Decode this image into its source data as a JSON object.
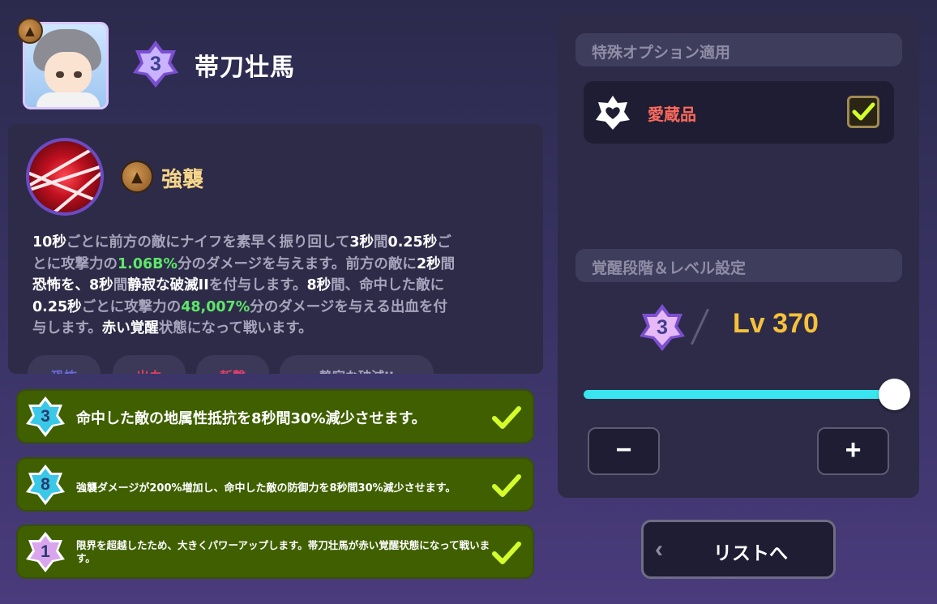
{
  "character": {
    "name": "帯刀壮馬",
    "awakening_stage": "3",
    "class_icon": "rock-class-icon"
  },
  "skill": {
    "name": "強襲",
    "icon": "red-slash-skill-icon",
    "class_icon": "rock-class-icon",
    "description": [
      [
        {
          "t": "10秒",
          "w": 1
        },
        {
          "t": "ごとに前方の敵にナイフを素早く振り回して"
        },
        {
          "t": "3秒",
          "w": 1
        },
        {
          "t": "間"
        },
        {
          "t": "0.25秒",
          "w": 1
        },
        {
          "t": "ご"
        }
      ],
      [
        {
          "t": "とに攻撃力の"
        },
        {
          "t": "1.06B%",
          "g": 1
        },
        {
          "t": "分のダメージを与えます。前方の敵に"
        },
        {
          "t": "2秒",
          "w": 1
        },
        {
          "t": "間"
        }
      ],
      [
        {
          "t": "恐怖を、",
          "w": 1
        },
        {
          "t": "8秒",
          "w": 1
        },
        {
          "t": "間"
        },
        {
          "t": "静寂な破滅II",
          "w": 1
        },
        {
          "t": "を付与します。"
        },
        {
          "t": "8秒",
          "w": 1
        },
        {
          "t": "間、命中した敵に"
        }
      ],
      [
        {
          "t": "0.25秒",
          "w": 1
        },
        {
          "t": "ごとに攻撃力の"
        },
        {
          "t": "48,007%",
          "g": 1
        },
        {
          "t": "分のダメージを与える出血を付"
        }
      ],
      [
        {
          "t": "与します。"
        },
        {
          "t": "赤い覚醒",
          "w": 1
        },
        {
          "t": "状態になって戦います。"
        }
      ]
    ],
    "tags": [
      {
        "label": "恐怖",
        "color": "#6e6be0"
      },
      {
        "label": "出血",
        "color": "#e0405a"
      },
      {
        "label": "斬撃",
        "color": "#e0406e"
      },
      {
        "label": "静寂な破滅II",
        "color": "#a9a6c2"
      }
    ]
  },
  "effects": [
    {
      "stage": "3",
      "badge_color": "#3ac8e8",
      "text": "命中した敵の地属性抵抗を8秒間30%減少させます。",
      "checked": true
    },
    {
      "stage": "8",
      "badge_color": "#3ac8e8",
      "text": "強襲ダメージが200%増加し、命中した敵の防御力を8秒間30%減少させます。",
      "checked": true
    },
    {
      "stage": "1",
      "badge_color": "#d9a6ee",
      "text": "限界を超越したため、大きくパワーアップします。帯刀壮馬が赤い覚醒状態になって戦います。",
      "checked": true
    }
  ],
  "options": {
    "section_title": "特殊オプション適用",
    "favorite_label": "愛蔵品",
    "favorite_checked": true
  },
  "level_settings": {
    "section_title": "覚醒段階＆レベル設定",
    "awakening_stage": "3",
    "level_text": "Lv 370",
    "slider_fraction": 1.0,
    "minus_label": "−",
    "plus_label": "+"
  },
  "back_button": {
    "label": "リストへ",
    "chevron": "‹"
  },
  "colors": {
    "accent_cyan": "#39e6f0",
    "level_gold": "#f6c13a",
    "effect_row_green": "#3f5f00",
    "check_lime": "#d4ff2a",
    "favorite_red": "#ff6a5c"
  }
}
